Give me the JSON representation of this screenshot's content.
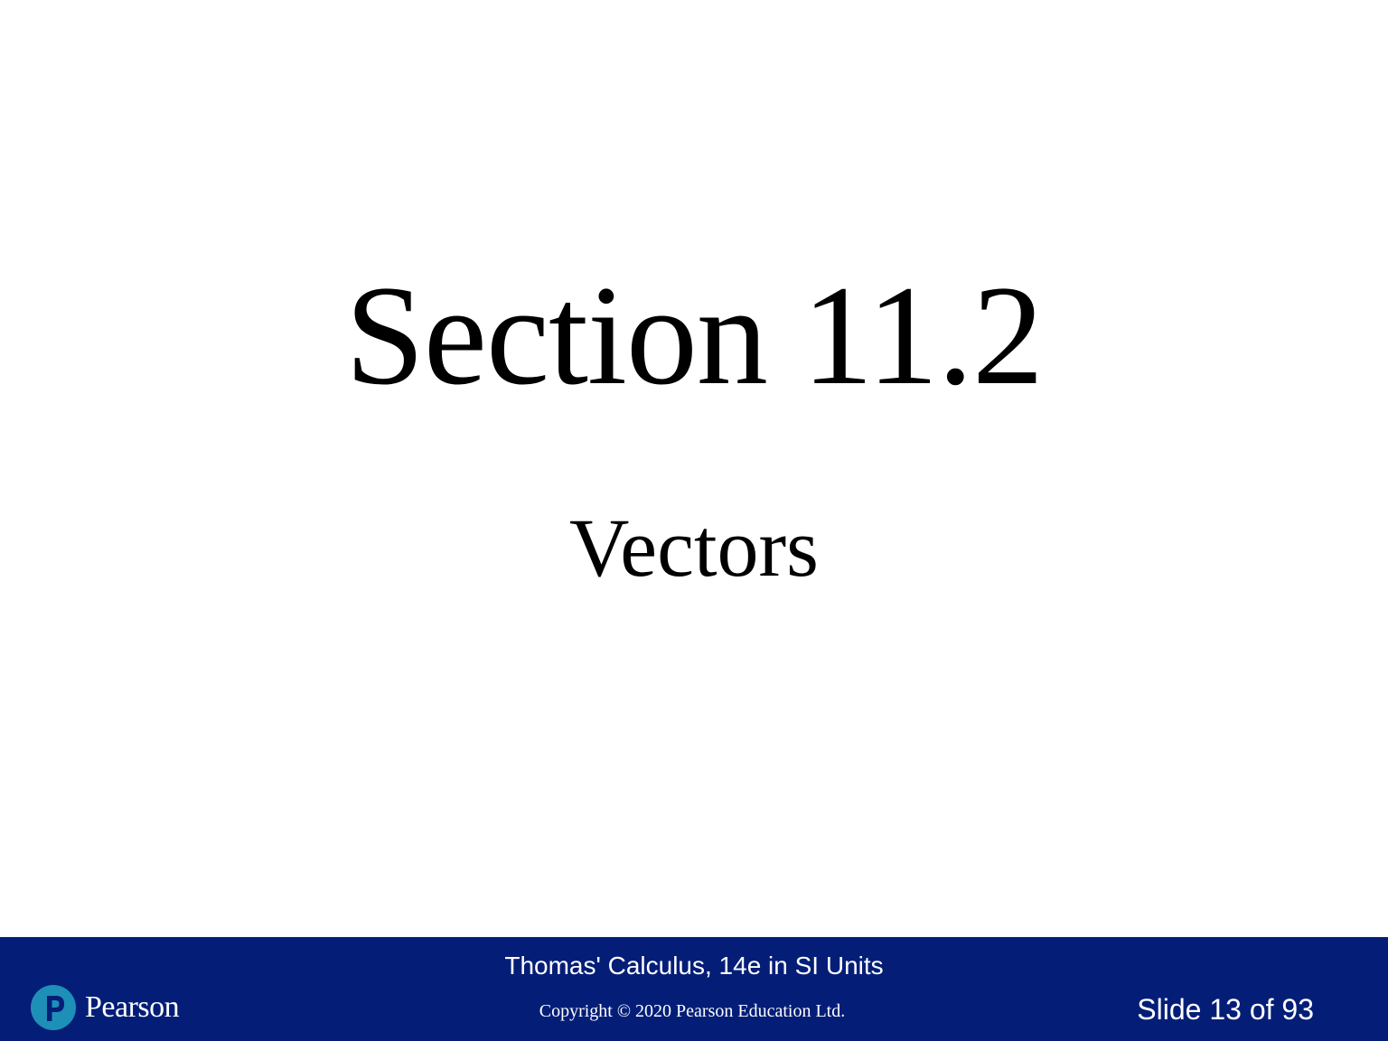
{
  "slide": {
    "title": "Section 11.2",
    "subtitle": "Vectors"
  },
  "footer": {
    "book_title": "Thomas' Calculus, 14e in SI Units",
    "copyright": "Copyright © 2020 Pearson Education Ltd.",
    "slide_counter": "Slide 13 of 93",
    "logo": {
      "wordmark": "Pearson",
      "icon": "pearson-p-logo-icon"
    },
    "background_color": "#041e78",
    "logo_color": "#1e90b8"
  }
}
